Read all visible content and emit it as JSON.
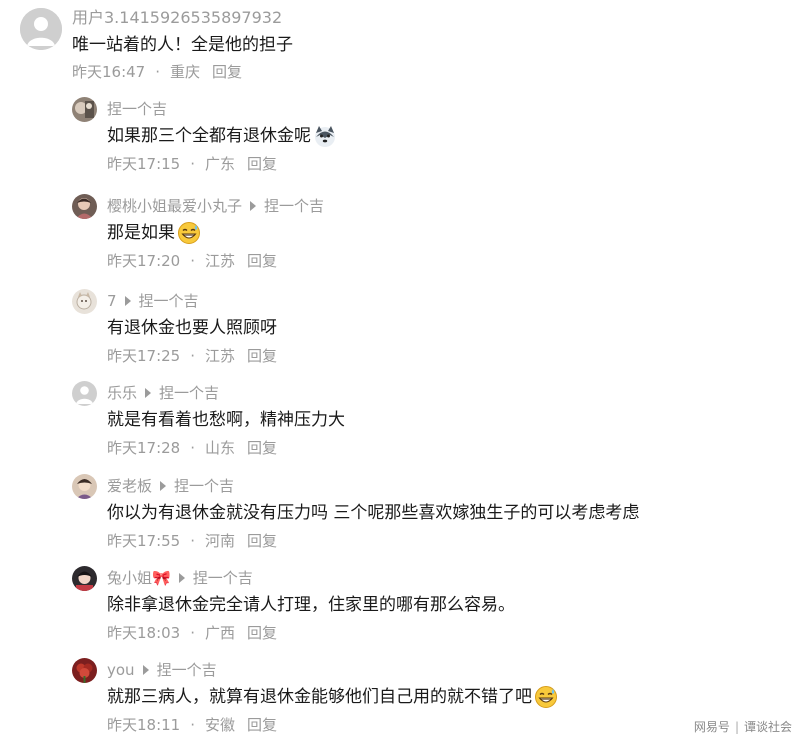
{
  "top_comment": {
    "username": "用户3.1415926535897932",
    "text": "唯一站着的人！全是他的担子",
    "time": "昨天16:47",
    "location": "重庆",
    "reply_label": "回复"
  },
  "separator": "·",
  "replies": [
    {
      "user": "捏一个吉",
      "reply_to": "",
      "text": "如果那三个全都有退休金呢",
      "emoji": "husky-emoji",
      "time": "昨天17:15",
      "location": "广东",
      "reply_label": "回复"
    },
    {
      "user": "樱桃小姐最爱小丸子",
      "reply_to": "捏一个吉",
      "text": "那是如果",
      "emoji": "grin-sweat-emoji",
      "time": "昨天17:20",
      "location": "江苏",
      "reply_label": "回复"
    },
    {
      "user": "7",
      "reply_to": "捏一个吉",
      "text": "有退休金也要人照顾呀",
      "emoji": "",
      "time": "昨天17:25",
      "location": "江苏",
      "reply_label": "回复"
    },
    {
      "user": "乐乐",
      "reply_to": "捏一个吉",
      "text": "就是有看着也愁啊，精神压力大",
      "emoji": "",
      "time": "昨天17:28",
      "location": "山东",
      "reply_label": "回复"
    },
    {
      "user": "爱老板",
      "reply_to": "捏一个吉",
      "text": "你以为有退休金就没有压力吗 三个呢那些喜欢嫁独生子的可以考虑考虑",
      "emoji": "",
      "time": "昨天17:55",
      "location": "河南",
      "reply_label": "回复"
    },
    {
      "user": "兔小姐🎀",
      "reply_to": "捏一个吉",
      "text": "除非拿退休金完全请人打理，住家里的哪有那么容易。",
      "emoji": "",
      "time": "昨天18:03",
      "location": "广西",
      "reply_label": "回复"
    },
    {
      "user": "you",
      "reply_to": "捏一个吉",
      "text": "就那三病人，就算有退休金能够他们自己用的就不错了吧",
      "emoji": "grin-sweat-emoji",
      "time": "昨天18:11",
      "location": "安徽",
      "reply_label": "回复"
    }
  ],
  "watermark": {
    "left": "网易号",
    "right": "谭谈社会"
  },
  "colors": {
    "text": "#1a1a1a",
    "meta": "#9b9b9b",
    "background": "#ffffff"
  }
}
